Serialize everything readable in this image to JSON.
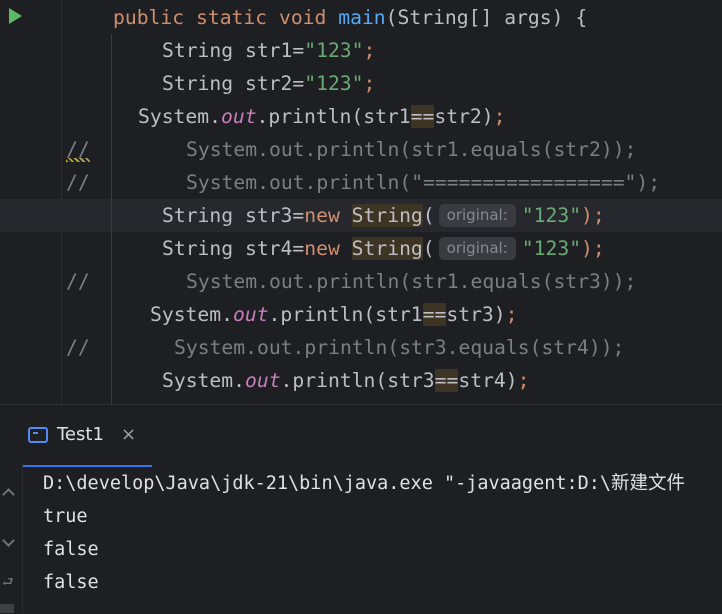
{
  "editor": {
    "line_main": {
      "kw1": "public",
      "kw2": "static",
      "kw3": "void",
      "fn": "main",
      "rest": "(String[] args) {"
    },
    "line_str1": {
      "type": "String str1=",
      "value": "\"123\"",
      "end": ";"
    },
    "line_str2": {
      "type": "String str2=",
      "value": "\"123\"",
      "end": ";"
    },
    "line_print1": {
      "pre": "System.",
      "field": "out",
      "call": ".println(str1",
      "op": "==",
      "post": "str2)",
      "end": ";"
    },
    "line_comment1": {
      "marker": "//",
      "text": "System.out.println(str1.equals(str2));"
    },
    "line_comment2": {
      "marker": "//",
      "text": "System.out.println(\"=================\");"
    },
    "line_str3": {
      "type": "String str3=",
      "kw": "new",
      "cls": "String",
      "paren": "(",
      "hint": "original:",
      "value": "\"123\"",
      "end": ");"
    },
    "line_str4": {
      "type": "String str4=",
      "kw": "new",
      "cls": "String",
      "paren": "(",
      "hint": "original:",
      "value": "\"123\"",
      "end": ");"
    },
    "line_comment3": {
      "marker": "//",
      "text": "System.out.println(str1.equals(str3));"
    },
    "line_print2": {
      "pre": "System.",
      "field": "out",
      "call": ".println(str1",
      "op": "==",
      "post": "str3)",
      "end": ";"
    },
    "line_comment4": {
      "marker": "//",
      "text": "System.out.println(str3.equals(str4));"
    },
    "line_print3": {
      "pre": "System.",
      "field": "out",
      "call": ".println(str3",
      "op": "==",
      "post": "str4)",
      "end": ";"
    }
  },
  "run_panel": {
    "tab_label": "Test1",
    "close_glyph": "×",
    "wrap_glyph": "⮐",
    "console_lines": [
      "D:\\develop\\Java\\jdk-21\\bin\\java.exe \"-javaagent:D:\\新建文件",
      "true",
      "false",
      "false"
    ]
  },
  "colors": {
    "keyword": "#cf8e6d",
    "function": "#56a8f5",
    "string": "#6aab73",
    "field": "#c77dbb",
    "comment": "#7a7e85",
    "text": "#bcbec4",
    "accent": "#3574f0",
    "run": "#5fb865"
  }
}
